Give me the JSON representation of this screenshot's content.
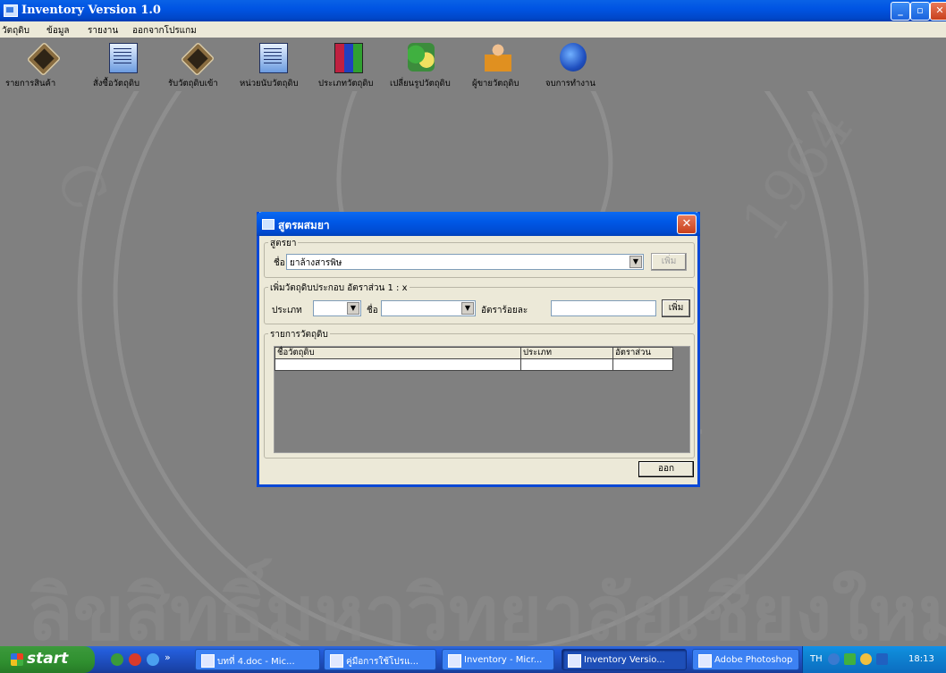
{
  "window": {
    "title": "Inventory Version 1.0"
  },
  "menu": [
    "วัตถุดิบ",
    "ข้อมูล",
    "รายงาน",
    "ออกจากโปรแกม"
  ],
  "toolbar": [
    {
      "label": "รายการสินค้า",
      "icon": "gem-icon"
    },
    {
      "label": "สั่งซื้อวัตถุดิบ",
      "icon": "document-icon"
    },
    {
      "label": "รับวัตถุดิบเข้า",
      "icon": "gem-icon"
    },
    {
      "label": "หน่วยนับวัตถุดิบ",
      "icon": "document-icon"
    },
    {
      "label": "ประเภทวัตถุดิบ",
      "icon": "books-icon"
    },
    {
      "label": "เปลี่ยนรูปวัตถุดิบ",
      "icon": "tools-icon"
    },
    {
      "label": "ผู้ขายวัตถุดิบ",
      "icon": "person-icon"
    },
    {
      "label": "จบการทำงาน",
      "icon": "globe-icon"
    }
  ],
  "dialog": {
    "title": "สูตรผสมยา",
    "formula_group": "สูตรยา",
    "name_label": "ชื่อ",
    "name_value": "ยาล้างสารพิษ",
    "add_button_disabled": "เพิ่ม",
    "ingredient_group": "เพิ่มวัตถุดิบประกอบ อัตราส่วน 1 : x",
    "type_label": "ประเภท",
    "type_value": "",
    "ing_name_label": "ชื่อ",
    "ing_name_value": "",
    "percent_label": "อัตราร้อยละ",
    "percent_value": "",
    "add_button": "เพิ่ม",
    "list_group": "รายการวัตถุดิบ",
    "columns": [
      "ชื่อวัตถุดิบ",
      "ประเภท",
      "อัตราส่วน"
    ],
    "exit_button": "ออก"
  },
  "watermark": {
    "text": "CHIANG MAI UNIVERSITY 1964",
    "footer": "ลิขสิทธิ์มหาวิทยาลัยเชียงใหม่"
  },
  "taskbar": {
    "start": "start",
    "tasks": [
      {
        "label": "บทที่ 4.doc - Mic...",
        "active": false
      },
      {
        "label": "คู่มือการใช้โปรแ...",
        "active": false
      },
      {
        "label": "Inventory - Micr...",
        "active": false
      },
      {
        "label": "Inventory Versio...",
        "active": true
      },
      {
        "label": "Adobe Photoshop",
        "active": false
      }
    ],
    "lang": "TH",
    "clock": "18:13"
  }
}
